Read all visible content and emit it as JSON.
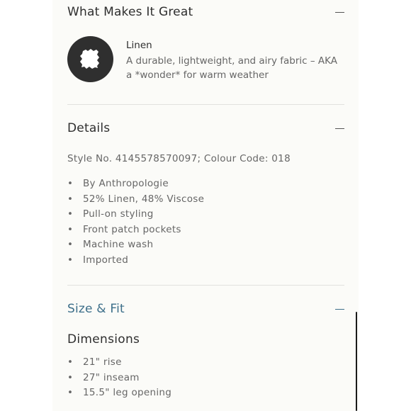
{
  "what_makes_it_great": {
    "title": "What Makes It Great",
    "feature": {
      "icon": "fabric-swatch-icon",
      "name": "Linen",
      "description": "A durable, lightweight, and airy fabric – AKA a *wonder* for warm weather"
    }
  },
  "details": {
    "title": "Details",
    "style_line": "Style No. 4145578570097; Colour Code: 018",
    "bullets": [
      "By Anthropologie",
      "52% Linen, 48% Viscose",
      "Pull-on styling",
      "Front patch pockets",
      "Machine wash",
      "Imported"
    ]
  },
  "size_fit": {
    "title": "Size & Fit",
    "accent_color": "#3d6f8a",
    "dimensions_title": "Dimensions",
    "dimensions": [
      "21\" rise",
      "27\" inseam",
      "15.5\" leg opening"
    ]
  },
  "bullet_char": "•"
}
